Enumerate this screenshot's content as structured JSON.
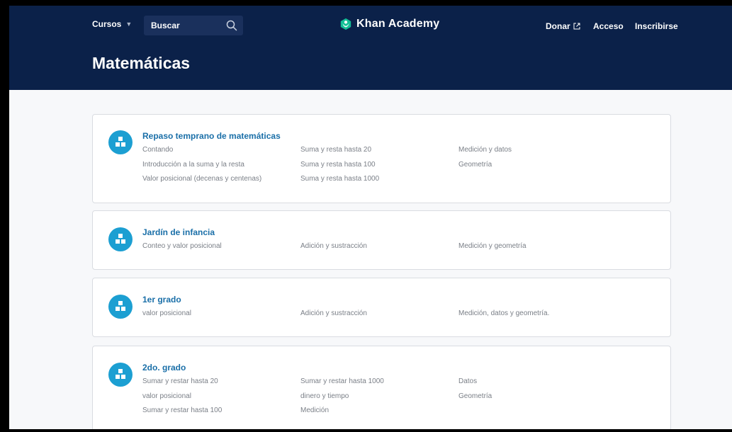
{
  "nav": {
    "courses_label": "Cursos",
    "search_placeholder": "Buscar",
    "logo_text": "Khan Academy",
    "donate_label": "Donar",
    "login_label": "Acceso",
    "signup_label": "Inscribirse"
  },
  "page": {
    "title": "Matemáticas"
  },
  "colors": {
    "nav_bg": "#0b2149",
    "icon_bg": "#1c9fd2",
    "title_link": "#1a6fa8",
    "logo_green": "#14bf96"
  },
  "courses": [
    {
      "title": "Repaso temprano de matemáticas",
      "col1": [
        "Contando",
        "Introducción a la suma y la resta",
        "Valor posicional (decenas y centenas)"
      ],
      "col2": [
        "Suma y resta hasta 20",
        "Suma y resta hasta 100",
        "Suma y resta hasta 1000"
      ],
      "col3": [
        "Medición y datos",
        "Geometría"
      ]
    },
    {
      "title": "Jardín de infancia",
      "col1": [
        "Conteo y valor posicional"
      ],
      "col2": [
        "Adición y sustracción"
      ],
      "col3": [
        "Medición y geometría"
      ]
    },
    {
      "title": "1er grado",
      "col1": [
        "valor posicional"
      ],
      "col2": [
        "Adición y sustracción"
      ],
      "col3": [
        "Medición, datos y geometría."
      ]
    },
    {
      "title": "2do. grado",
      "col1": [
        "Sumar y restar hasta 20",
        "valor posicional",
        "Sumar y restar hasta 100"
      ],
      "col2": [
        "Sumar y restar hasta 1000",
        "dinero y tiempo",
        "Medición"
      ],
      "col3": [
        "Datos",
        "Geometría"
      ]
    }
  ]
}
